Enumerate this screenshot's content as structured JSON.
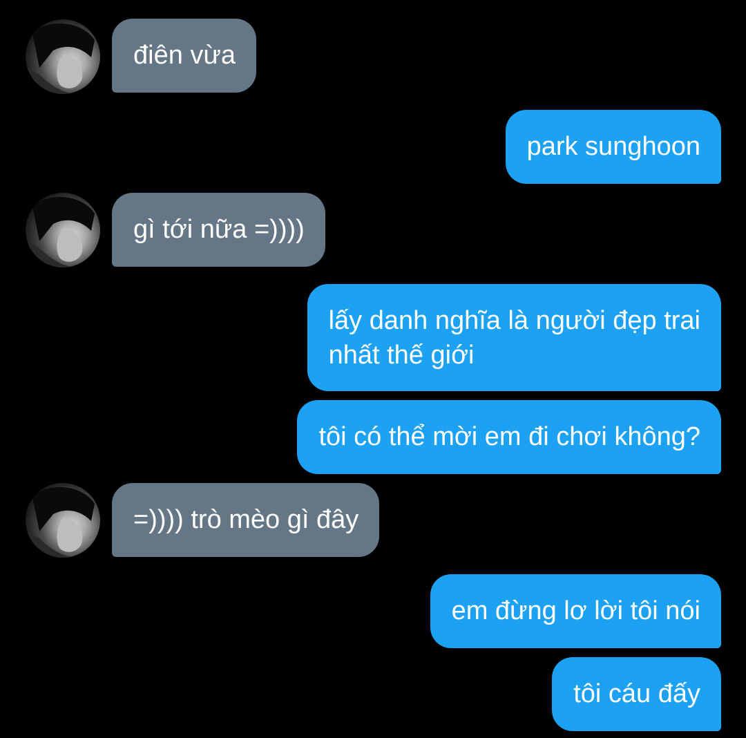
{
  "conversation": {
    "messages": [
      {
        "sender": "other",
        "text": "điên vừa"
      },
      {
        "sender": "me",
        "text": "park sunghoon"
      },
      {
        "sender": "other",
        "text": "gì tới nữa =))))"
      },
      {
        "sender": "me",
        "text_line1": "lấy danh nghĩa là người đẹp trai",
        "text_line2": "nhất thế giới"
      },
      {
        "sender": "me",
        "text": "tôi có thể mời em đi chơi không?"
      },
      {
        "sender": "other",
        "text": "=)))) trò mèo gì đây"
      },
      {
        "sender": "me",
        "text": "em đừng lơ lời tôi nói"
      },
      {
        "sender": "me",
        "text": "tôi cáu đấy"
      }
    ]
  },
  "colors": {
    "background": "#000000",
    "incoming_bubble": "#657786",
    "outgoing_bubble": "#1da1f2",
    "text": "#ffffff"
  },
  "icons": {
    "avatar": "contact-avatar-photo"
  }
}
